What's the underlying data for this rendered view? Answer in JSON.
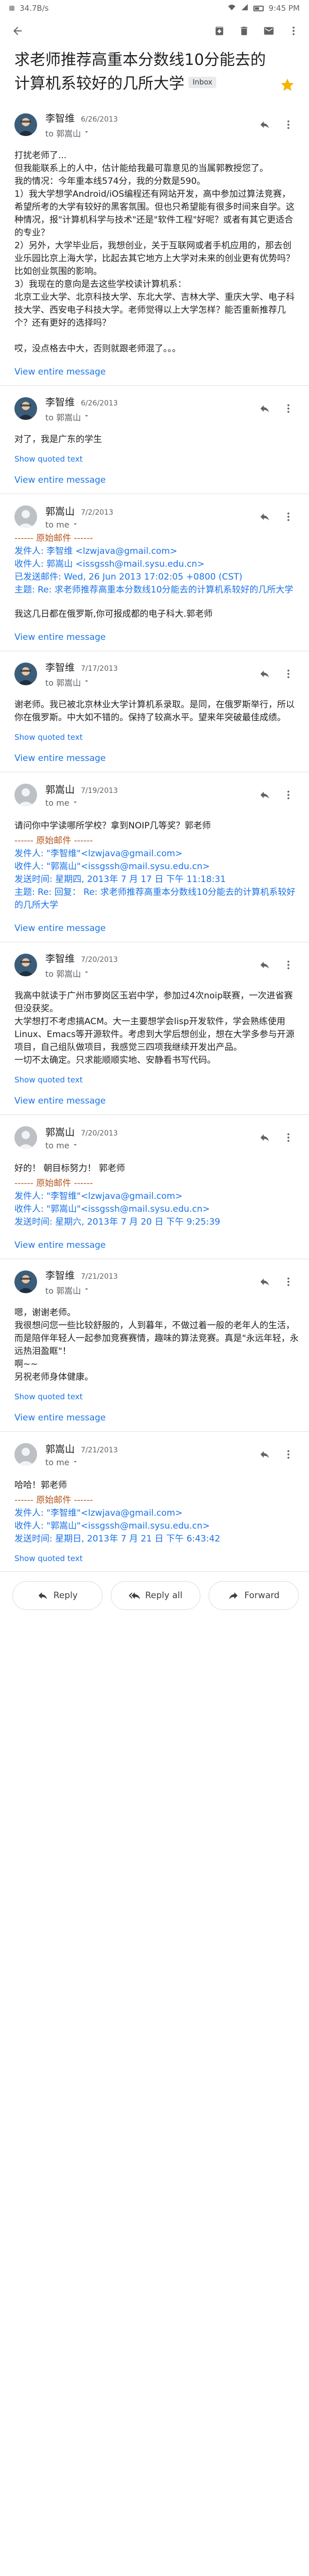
{
  "status_bar": {
    "left_text": "34.7B/s",
    "right_text": "9:45 PM"
  },
  "subject": {
    "title": "求老师推荐高重本分数线10分能去的计算机系较好的几所大学",
    "label": "Inbox"
  },
  "messages": [
    {
      "sender": "李智维",
      "date": "6/26/2013",
      "to": "to 郭嵩山",
      "avatar": "photo",
      "body": "打扰老师了...\n但我能联系上的人中，估计能给我最可靠意见的当属郭教授您了。\n我的情况：今年重本线574分，我的分数是590。\n1）我大学想学Android/iOS编程还有网站开发，高中参加过算法竞赛，希望所考的大学有较好的黑客氛围。但也只希望能有很多时间来自学。这种情况，报\"计算机科学与技术\"还是\"软件工程\"好呢？或者有其它更适合的专业？\n2）另外，大学毕业后，我想创业，关于互联网或者手机应用的，那去创业乐园比京上海大学，比起去其它地方上大学对未来的创业更有优势吗？比如创业氛围的影响。\n3）我现在的意向是去这些学校读计算机系：\n北京工业大学、北京科技大学、东北大学、吉林大学、重庆大学、电子科技大学、西安电子科技大学。老师觉得以上大学怎样？能否重新推荐几个？还有更好的选择吗？\n\n哎，没点格去中大，否则就跟老师混了。。。",
      "show_quoted": false,
      "view_entire": "View entire message"
    },
    {
      "sender": "李智维",
      "date": "6/26/2013",
      "to": "to 郭嵩山",
      "avatar": "photo",
      "body": "对了，我是广东的学生",
      "show_quoted": "Show quoted text",
      "view_entire": "View entire message"
    },
    {
      "sender": "郭嵩山",
      "date": "7/2/2013",
      "to": "to me",
      "avatar": "silhouette",
      "body": "",
      "quoted": {
        "header": "------ 原始邮件 ------",
        "from_label": "发件人: 李智维 <",
        "from_email": "lzwjava@gmail.com",
        "to_label": "收件人: 郭嵩山 <",
        "to_email": "issgssh@mail.sysu.edu.cn",
        "sent": "已发送邮件: Wed, 26 Jun 2013 17:02:05 +0800 (CST)",
        "subject": "主题: Re: 求老师推荐高重本分数线10分能去的计算机系较好的几所大学"
      },
      "body_after": "我这几日都在俄罗斯,你可报成都的电子科大.郭老师",
      "show_quoted": false,
      "view_entire": "View entire message"
    },
    {
      "sender": "李智维",
      "date": "7/17/2013",
      "to": "to 郭嵩山",
      "avatar": "photo",
      "body": "谢老师。我已被北京林业大学计算机系录取。是同，在俄罗斯举行，所以你在俄罗斯。中大如不错的。保持了较高水平。望来年突破最佳成绩。",
      "show_quoted": "Show quoted text",
      "view_entire": "View entire message"
    },
    {
      "sender": "郭嵩山",
      "date": "7/19/2013",
      "to": "to me",
      "avatar": "silhouette",
      "body": "请问你中学读哪所学校？拿到NOIP几等奖？郭老师",
      "quoted": {
        "header": "------ 原始邮件 ------",
        "from_label": "发件人: \"李智维\"<",
        "from_email": "lzwjava@gmail.com",
        "to_label": "收件人: \"郭嵩山\"<",
        "to_email": "issgssh@mail.sysu.edu.cn",
        "sent": "发送时间: 星期四, 2013年 7 月 17 日 下午 11:18:31",
        "subject": "主题: Re: 回复： Re: 求老师推荐高重本分数线10分能去的计算机系较好的几所大学"
      },
      "body_after": "",
      "show_quoted": false,
      "view_entire": "View entire message"
    },
    {
      "sender": "李智维",
      "date": "7/20/2013",
      "to": "to 郭嵩山",
      "avatar": "photo",
      "body": "我高中就读于广州市萝岗区玉岩中学，参加过4次noip联赛，一次进省赛但没获奖。\n大学想打不考虑搞ACM。大一主要想学会lisp开发软件，学会熟练使用Linux、Emacs等开源软件。考虑到大学后想创业，想在大学多参与开源项目，自己组队做项目，我感觉三四项我继续开发出产品。\n一切不太确定。只求能顺顺实地、安静看书写代码。",
      "show_quoted": "Show quoted text",
      "view_entire": "View entire message"
    },
    {
      "sender": "郭嵩山",
      "date": "7/20/2013",
      "to": "to me",
      "avatar": "silhouette",
      "body": "好的！ 朝目标努力！ 郭老师",
      "quoted": {
        "header": "------ 原始邮件 ------",
        "from_label": "发件人: \"李智维\"<",
        "from_email": "lzwjava@gmail.com",
        "to_label": "收件人: \"郭嵩山\"<",
        "to_email": "issgssh@mail.sysu.edu.cn",
        "sent": "发送时间: 星期六, 2013年 7 月 20 日 下午 9:25:39",
        "subject": ""
      },
      "body_after": "",
      "show_quoted": false,
      "view_entire": "View entire message"
    },
    {
      "sender": "李智维",
      "date": "7/21/2013",
      "to": "to 郭嵩山",
      "avatar": "photo",
      "body": "嗯，谢谢老师。\n我很想问您一些比较舒服的，人到暮年，不做过着一般的老年人的生活，而是陪伴年轻人一起参加竞赛赛情，趣味的算法竞赛。真是\"永远年轻，永远热泪盈眶\"！\n啊~~\n另祝老师身体健康。",
      "show_quoted": "Show quoted text",
      "view_entire": "View entire message"
    },
    {
      "sender": "郭嵩山",
      "date": "7/21/2013",
      "to": "to me",
      "avatar": "silhouette",
      "body": "哈哈！郭老师",
      "quoted": {
        "header": "------ 原始邮件 ------",
        "from_label": "发件人: \"李智维\"<",
        "from_email": "lzwjava@gmail.com",
        "to_label": "收件人: \"郭嵩山\"<",
        "to_email": "issgssh@mail.sysu.edu.cn",
        "sent": "发送时间: 星期日, 2013年 7 月 21 日 下午 6:43:42",
        "subject": ""
      },
      "body_after": "",
      "show_quoted": "Show quoted text",
      "view_entire": ""
    }
  ],
  "actions": {
    "reply": "Reply",
    "reply_all": "Reply all",
    "forward": "Forward"
  },
  "colors": {
    "link": "#1a73e8",
    "star": "#f4b400",
    "quoted_header": "#b4561f"
  }
}
